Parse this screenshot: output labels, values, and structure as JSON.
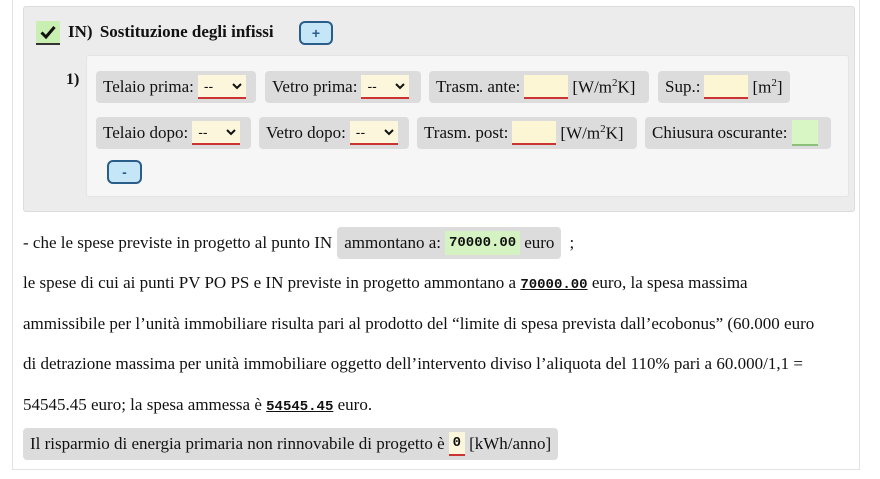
{
  "section": {
    "prefix": "IN)",
    "title": "Sostituzione degli infissi",
    "add_label": "+",
    "remove_label": "-",
    "row_number": "1)"
  },
  "fields": {
    "telaio_prima": "Telaio prima:",
    "vetro_prima": "Vetro prima:",
    "trasm_ante": "Trasm. ante:",
    "sup": "Sup.:",
    "telaio_dopo": "Telaio dopo:",
    "vetro_dopo": "Vetro dopo:",
    "trasm_post": "Trasm. post:",
    "chiusura": "Chiusura oscurante:",
    "select_value": "--",
    "unit_w_a": "[W/m",
    "unit_w_sup": "2",
    "unit_w_b": "K]",
    "unit_m_a": "[m",
    "unit_m_sup": "2",
    "unit_m_b": "]"
  },
  "text": {
    "line1_a": "- che le spese previste in progetto al punto IN",
    "line1_label": "ammontano a:",
    "line1_value": "70000.00",
    "line1_unit": "euro",
    "line1_end": ";",
    "line2_a": "le spese di cui ai punti PV PO PS e IN previste in progetto ammontano a",
    "line2_value": "70000.00",
    "line2_b": "euro, la spesa massima",
    "line3": "ammissibile per l’unità immobiliare risulta pari al prodotto del “limite di spesa prevista dall’ecobonus” (60.000 euro",
    "line4": "di detrazione massima per unità immobiliare oggetto dell’intervento diviso l’aliquota del 110% pari a 60.000/1,1 =",
    "line5_a": "54545.45 euro; la spesa ammessa è",
    "line5_value": "54545.45",
    "line5_b": "euro.",
    "line6_a": "Il risparmio di energia primaria non rinnovabile di progetto è",
    "line6_value": "0",
    "line6_b": "[kWh/anno]"
  }
}
